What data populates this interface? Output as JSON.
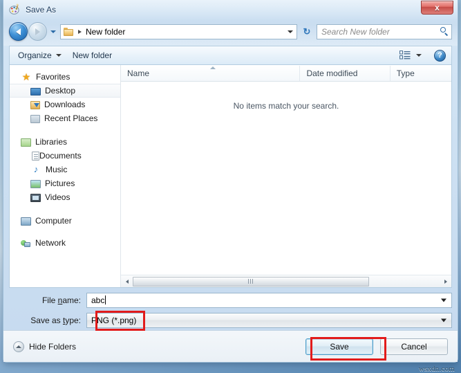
{
  "window": {
    "title": "Save As",
    "icon": "paint-palette-icon",
    "close_label": "x"
  },
  "address": {
    "back_icon": "back-arrow-icon",
    "forward_icon": "forward-arrow-icon",
    "recent_icon": "chevron-down-icon",
    "folder_icon": "folder-icon",
    "breadcrumb": "New folder",
    "dropdown_icon": "chevron-down-icon",
    "refresh_icon": "refresh-icon",
    "refresh_glyph": "↻"
  },
  "search": {
    "placeholder": "Search New folder",
    "icon": "search-icon"
  },
  "toolbar": {
    "organize_label": "Organize",
    "new_folder_label": "New folder",
    "view_icon": "view-list-icon",
    "help_label": "?"
  },
  "sidebar": {
    "groups": [
      {
        "header": "Favorites",
        "icon": "star-icon",
        "items": [
          {
            "label": "Desktop",
            "icon": "desktop-icon",
            "selected": true
          },
          {
            "label": "Downloads",
            "icon": "downloads-icon",
            "selected": false
          },
          {
            "label": "Recent Places",
            "icon": "recent-places-icon",
            "selected": false
          }
        ]
      },
      {
        "header": "Libraries",
        "icon": "libraries-icon",
        "items": [
          {
            "label": "Documents",
            "icon": "documents-icon",
            "selected": false
          },
          {
            "label": "Music",
            "icon": "music-icon",
            "selected": false
          },
          {
            "label": "Pictures",
            "icon": "pictures-icon",
            "selected": false
          },
          {
            "label": "Videos",
            "icon": "videos-icon",
            "selected": false
          }
        ]
      },
      {
        "header": "Computer",
        "icon": "computer-icon",
        "items": []
      },
      {
        "header": "Network",
        "icon": "network-icon",
        "items": []
      }
    ]
  },
  "filelist": {
    "columns": [
      "Name",
      "Date modified",
      "Type"
    ],
    "sort_column": "Name",
    "sort_direction": "ascending",
    "rows": [],
    "empty_message": "No items match your search."
  },
  "form": {
    "filename_label_pre": "File ",
    "filename_label_accel": "n",
    "filename_label_post": "ame:",
    "filename_value": "abc",
    "savetype_label_pre": "Save as ",
    "savetype_label_accel": "t",
    "savetype_label_post": "ype:",
    "savetype_value": "PNG (*.png)"
  },
  "footer": {
    "hide_folders_label": "Hide Folders",
    "hide_folders_icon": "chevron-up-icon",
    "save_label": "Save",
    "cancel_label": "Cancel"
  },
  "annotations": {
    "highlight_color": "#e21b1b",
    "boxes": [
      "save-as-type-combo",
      "save-button"
    ]
  },
  "watermark": "wsxdn.com"
}
